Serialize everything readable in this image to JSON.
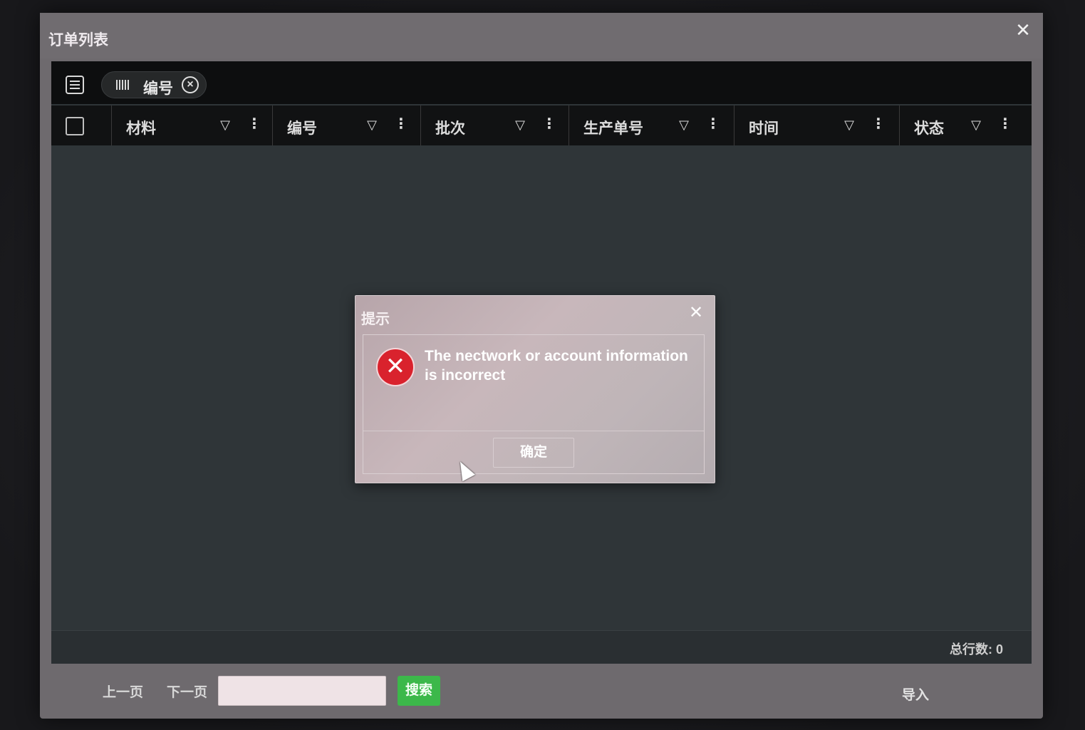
{
  "window": {
    "title": "订单列表",
    "close_glyph": "✕"
  },
  "group_bar": {
    "chip_label": "编号"
  },
  "columns": [
    {
      "label": "材料"
    },
    {
      "label": "编号"
    },
    {
      "label": "批次"
    },
    {
      "label": "生产单号"
    },
    {
      "label": "时间"
    },
    {
      "label": "状态"
    }
  ],
  "grid_footer": {
    "row_count": "总行数: 0"
  },
  "bottom_bar": {
    "prev_label": "上一页",
    "next_label": "下一页",
    "page_input_value": "",
    "search_label": "搜索",
    "import_label": "导入"
  },
  "dialog": {
    "title": "提示",
    "close_glyph": "✕",
    "message": "The nectwork or account information is incorrect",
    "ok_label": "确定",
    "icon": "error-x-icon"
  },
  "colors": {
    "error_red": "#d9222d",
    "search_green": "#3cb84a"
  }
}
